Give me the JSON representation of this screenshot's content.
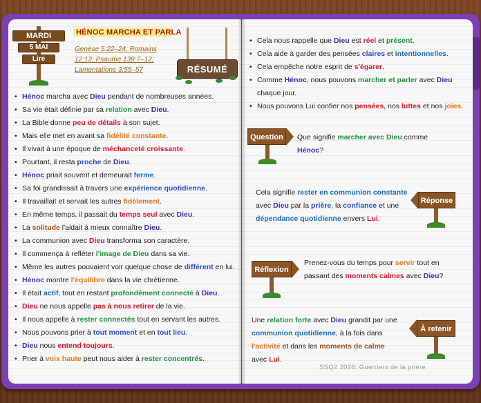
{
  "date_sign": {
    "day": "MARDI",
    "date": "5 MAI",
    "action": "Lire"
  },
  "lesson": {
    "title": "HÉNOC MARCHA ET PARLA",
    "refs": [
      "Genèse 5:22–24; Romains",
      "12:12; Psaume 139:7–12;",
      "Lamentations 3:55–57"
    ]
  },
  "resume_label": "RÉSUMÉ",
  "left_bullets": [
    [
      [
        "Hénoc",
        "navy"
      ],
      [
        " marcha avec ",
        ""
      ],
      [
        "Dieu",
        "navy"
      ],
      [
        " pendant de nombreuses années.",
        ""
      ]
    ],
    [
      [
        "Sa vie était définie par sa ",
        ""
      ],
      [
        "relation",
        "green"
      ],
      [
        " avec ",
        ""
      ],
      [
        "Dieu",
        "navy"
      ],
      [
        ".",
        ""
      ]
    ],
    [
      [
        "La Bible donne ",
        ""
      ],
      [
        "peu de détails",
        "red"
      ],
      [
        " à son sujet.",
        ""
      ]
    ],
    [
      [
        "Mais elle met en avant sa ",
        ""
      ],
      [
        "fidélité constante",
        "orange"
      ],
      [
        ".",
        ""
      ]
    ],
    [
      [
        "Il vivait à une époque de ",
        ""
      ],
      [
        "méchanceté croissante",
        "red"
      ],
      [
        ".",
        ""
      ]
    ],
    [
      [
        "Pourtant, il resta ",
        ""
      ],
      [
        "proche",
        "blue"
      ],
      [
        " de ",
        ""
      ],
      [
        "Dieu",
        "navy"
      ],
      [
        ".",
        ""
      ]
    ],
    [
      [
        "Hénoc",
        "navy"
      ],
      [
        " priait souvent et demeurait ",
        ""
      ],
      [
        "ferme",
        "teal"
      ],
      [
        ".",
        ""
      ]
    ],
    [
      [
        "Sa foi grandissait à travers une ",
        ""
      ],
      [
        "expérience quotidienne",
        "blue"
      ],
      [
        ".",
        ""
      ]
    ],
    [
      [
        "Il travaillait et servait les autres ",
        ""
      ],
      [
        "fidèlement",
        "orange"
      ],
      [
        ".",
        ""
      ]
    ],
    [
      [
        "En même temps, il passait du ",
        ""
      ],
      [
        "temps seul",
        "red"
      ],
      [
        " avec ",
        ""
      ],
      [
        "Dieu",
        "navy"
      ],
      [
        ".",
        ""
      ]
    ],
    [
      [
        "La ",
        ""
      ],
      [
        "solitude",
        "brown"
      ],
      [
        " l'aidait à mieux connaître ",
        ""
      ],
      [
        "Dieu",
        "navy"
      ],
      [
        ".",
        ""
      ]
    ],
    [
      [
        "La communion avec ",
        ""
      ],
      [
        "Dieu",
        "red"
      ],
      [
        " transforma son caractère.",
        ""
      ]
    ],
    [
      [
        "Il commença à refléter ",
        ""
      ],
      [
        "l'image de Dieu",
        "green"
      ],
      [
        " dans sa vie.",
        ""
      ]
    ],
    [
      [
        "Même les autres pouvaient voir quelque chose de ",
        ""
      ],
      [
        "différent",
        "blue"
      ],
      [
        " en lui.",
        ""
      ]
    ],
    [
      [
        "Hénoc",
        "navy"
      ],
      [
        " montre ",
        ""
      ],
      [
        "l'équilibre",
        "orange"
      ],
      [
        " dans la vie chrétienne.",
        ""
      ]
    ],
    [
      [
        "Il était ",
        ""
      ],
      [
        "actif",
        "teal"
      ],
      [
        ", tout en restant ",
        ""
      ],
      [
        "profondément connecté",
        "green"
      ],
      [
        " à ",
        ""
      ],
      [
        "Dieu",
        "navy"
      ],
      [
        ".",
        ""
      ]
    ],
    [
      [
        "Dieu",
        "red"
      ],
      [
        " ne nous appelle ",
        ""
      ],
      [
        "pas à nous retirer",
        "red"
      ],
      [
        " de la vie.",
        ""
      ]
    ],
    [
      [
        "Il nous appelle à ",
        ""
      ],
      [
        "rester connectés",
        "green"
      ],
      [
        " tout en servant les autres.",
        ""
      ]
    ],
    [
      [
        "Nous pouvons prier à ",
        ""
      ],
      [
        "tout moment",
        "blue"
      ],
      [
        " et en ",
        ""
      ],
      [
        "tout lieu",
        "blue"
      ],
      [
        ".",
        ""
      ]
    ],
    [
      [
        "Dieu",
        "navy"
      ],
      [
        " nous ",
        ""
      ],
      [
        "entend toujours",
        "red"
      ],
      [
        ".",
        ""
      ]
    ],
    [
      [
        "Prier à ",
        ""
      ],
      [
        "voix haute",
        "orange"
      ],
      [
        " peut nous aider à ",
        ""
      ],
      [
        "rester concentrés",
        "green"
      ],
      [
        ".",
        ""
      ]
    ]
  ],
  "right_bullets": [
    {
      "cont": false,
      "parts": [
        [
          "Cela nous rappelle que ",
          ""
        ],
        [
          "Dieu",
          "navy"
        ],
        [
          " est ",
          ""
        ],
        [
          "réel",
          "red"
        ],
        [
          " et ",
          ""
        ],
        [
          "présent",
          "green"
        ],
        [
          ".",
          ""
        ]
      ]
    },
    {
      "cont": false,
      "parts": [
        [
          "Cela aide à garder des pensées ",
          ""
        ],
        [
          "claires",
          "blue"
        ],
        [
          " et ",
          ""
        ],
        [
          "intentionnelles",
          "teal"
        ],
        [
          ".",
          ""
        ]
      ]
    },
    {
      "cont": false,
      "parts": [
        [
          "Cela empêche notre esprit de ",
          ""
        ],
        [
          "s'égarer",
          "red"
        ],
        [
          ".",
          ""
        ]
      ]
    },
    {
      "cont": false,
      "parts": [
        [
          "Comme ",
          ""
        ],
        [
          "Hénoc",
          "navy"
        ],
        [
          ", nous pouvons ",
          ""
        ],
        [
          "marcher et parler",
          "green"
        ],
        [
          " avec ",
          ""
        ],
        [
          "Dieu",
          "navy"
        ]
      ]
    },
    {
      "cont": true,
      "parts": [
        [
          "chaque jour.",
          ""
        ]
      ]
    },
    {
      "cont": false,
      "parts": [
        [
          "Nous pouvons Lui confier nos ",
          ""
        ],
        [
          "pensées",
          "red"
        ],
        [
          ", nos ",
          ""
        ],
        [
          "luttes",
          "red"
        ],
        [
          " et nos ",
          ""
        ],
        [
          "joies",
          "orange"
        ],
        [
          ".",
          ""
        ]
      ]
    }
  ],
  "question": {
    "label": "Question",
    "lines": [
      [
        [
          "Que signifie ",
          ""
        ],
        [
          "marcher avec Dieu",
          "green"
        ],
        [
          " comme",
          ""
        ]
      ],
      [
        [
          "Hénoc",
          "navy"
        ],
        [
          "?",
          ""
        ]
      ]
    ]
  },
  "reponse": {
    "label": "Réponse",
    "lines": [
      [
        [
          "Cela signifie ",
          ""
        ],
        [
          "rester en communion constante",
          "teal"
        ]
      ],
      [
        [
          "avec ",
          ""
        ],
        [
          "Dieu",
          "navy"
        ],
        [
          " par la ",
          ""
        ],
        [
          "prière",
          "blue"
        ],
        [
          ", la ",
          ""
        ],
        [
          "confiance",
          "blue"
        ],
        [
          " et une",
          ""
        ]
      ],
      [
        [
          "dépendance quotidienne",
          "teal"
        ],
        [
          " envers ",
          ""
        ],
        [
          "Lui",
          "red"
        ],
        [
          ".",
          ""
        ]
      ]
    ]
  },
  "reflexion": {
    "label": "Réflexion",
    "lines": [
      [
        [
          "Prenez-vous du temps pour ",
          ""
        ],
        [
          "servir",
          "orange"
        ],
        [
          " tout en",
          ""
        ]
      ],
      [
        [
          "passant des ",
          ""
        ],
        [
          "moments calmes",
          "red"
        ],
        [
          " avec ",
          ""
        ],
        [
          "Dieu",
          "navy"
        ],
        [
          "?",
          ""
        ]
      ]
    ]
  },
  "retenir": {
    "label": "À retenir",
    "lines": [
      [
        [
          "Une ",
          ""
        ],
        [
          "relation forte",
          "green"
        ],
        [
          " avec ",
          ""
        ],
        [
          "Dieu",
          "navy"
        ],
        [
          " grandit par une",
          ""
        ]
      ],
      [
        [
          "communion quotidienne",
          "teal"
        ],
        [
          ", à la fois dans",
          ""
        ]
      ],
      [
        [
          "l'activité",
          "orange"
        ],
        [
          " et dans les ",
          ""
        ],
        [
          "moments de calme",
          "brown"
        ]
      ],
      [
        [
          "avec ",
          ""
        ],
        [
          "Lui",
          "red"
        ],
        [
          ".",
          ""
        ]
      ]
    ]
  },
  "footer": "SSQ2 2026:  Guerriers de la prière",
  "colors": {
    "book": "#7c3fb5",
    "wood": "#8b5526",
    "highlight": "#fdeb8a"
  }
}
